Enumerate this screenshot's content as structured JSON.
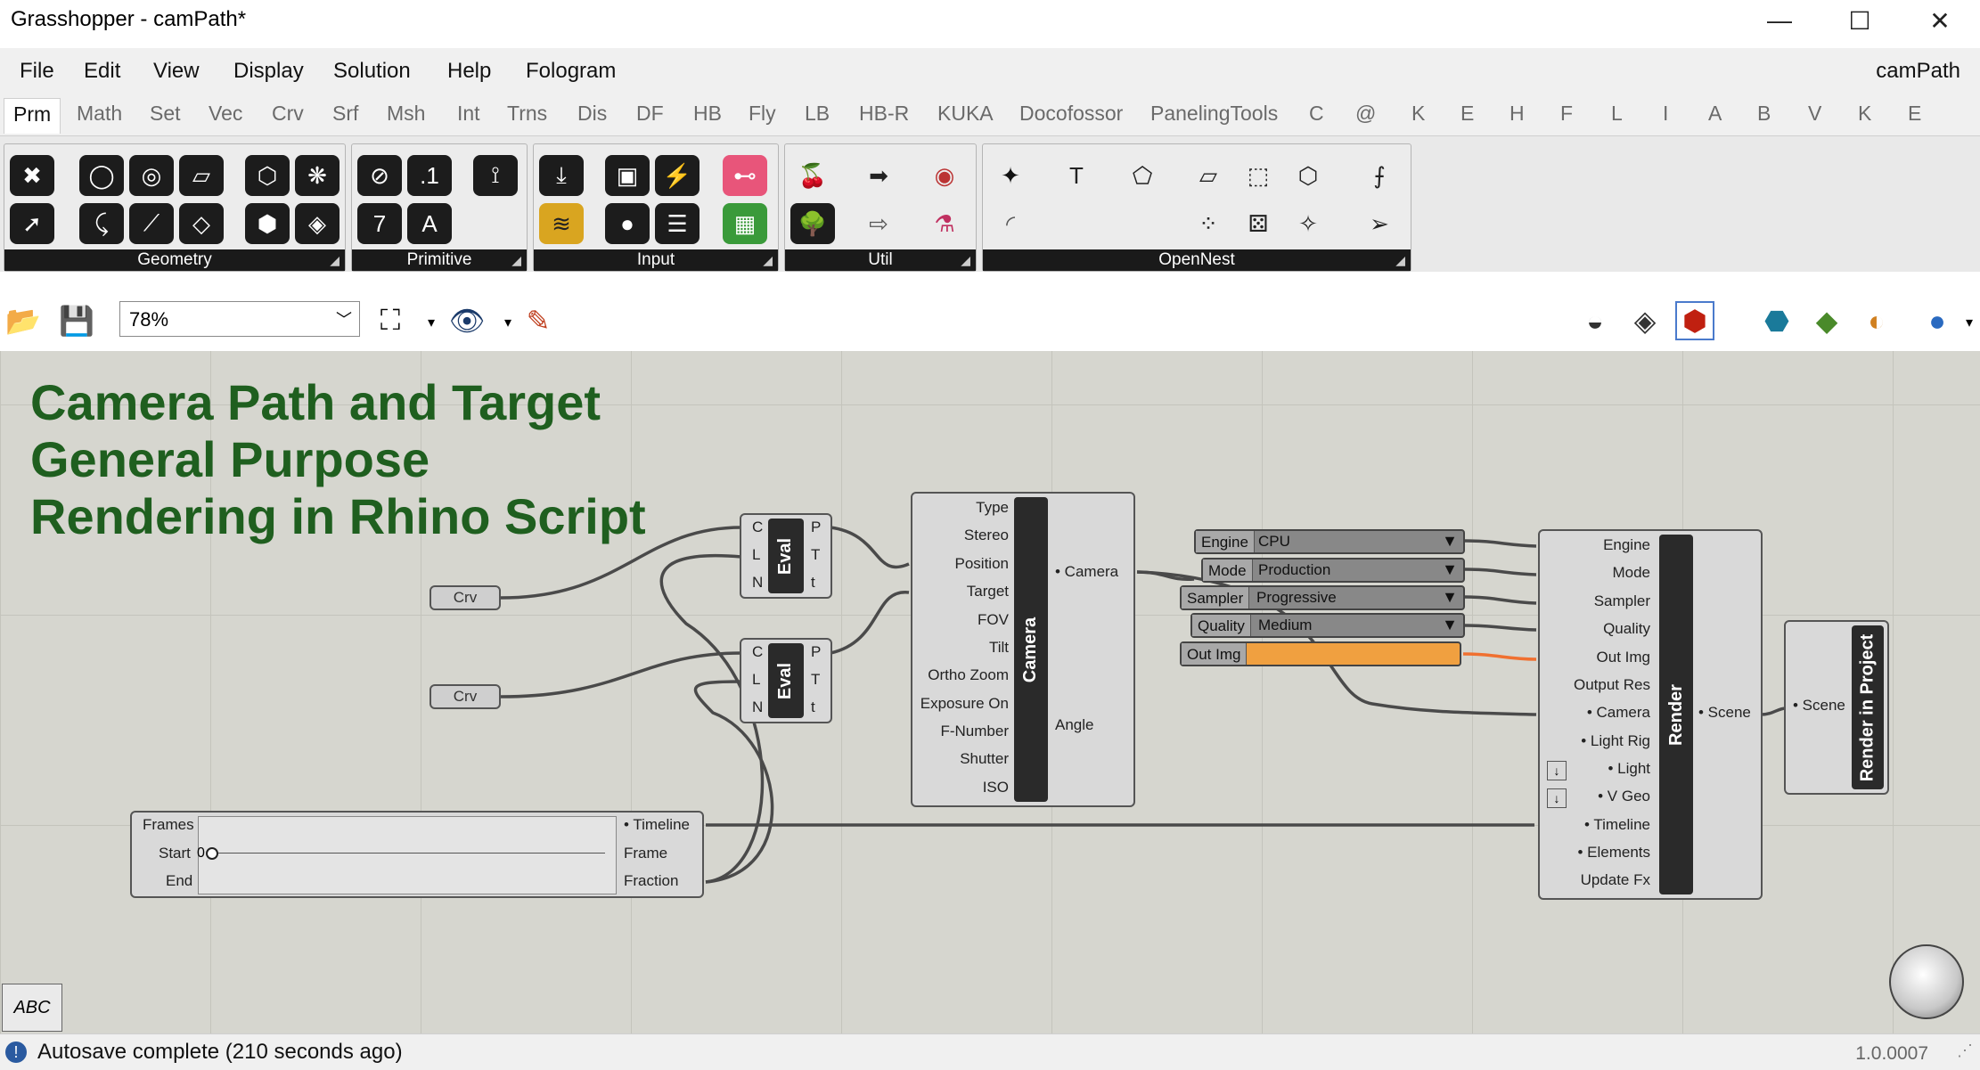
{
  "window": {
    "title": "Grasshopper - camPath*",
    "minimize": "—",
    "maximize": "☐",
    "close": "✕"
  },
  "menu": {
    "items": [
      "File",
      "Edit",
      "View",
      "Display",
      "Solution",
      "Help",
      "Fologram"
    ],
    "document_name": "camPath"
  },
  "tabs": [
    "Prm",
    "Math",
    "Set",
    "Vec",
    "Crv",
    "Srf",
    "Msh",
    "Int",
    "Trns",
    "Dis",
    "DF",
    "HB",
    "Fly",
    "LB",
    "HB-R",
    "KUKA",
    "Docofossor",
    "PanelingTools",
    "C",
    "@",
    "K",
    "E",
    "H",
    "F",
    "L",
    "I",
    "A",
    "B",
    "V",
    "K",
    "E"
  ],
  "active_tab": "Prm",
  "ribbon": {
    "panels": [
      "Geometry",
      "Primitive",
      "Input",
      "Util",
      "OpenNest"
    ]
  },
  "canvas_toolbar": {
    "zoom": "78%"
  },
  "note": {
    "line1": "Camera Path and Target",
    "line2": "General Purpose",
    "line3": "Rendering in Rhino Script"
  },
  "components": {
    "crv1": "Crv",
    "crv2": "Crv",
    "eval1": {
      "title": "Eval",
      "inputs": [
        "C",
        "L",
        "N"
      ],
      "outputs": [
        "P",
        "T",
        "t"
      ]
    },
    "eval2": {
      "title": "Eval",
      "inputs": [
        "C",
        "L",
        "N"
      ],
      "outputs": [
        "P",
        "T",
        "t"
      ]
    },
    "camera": {
      "title": "Camera",
      "inputs": [
        "Type",
        "Stereo",
        "Position",
        "Target",
        "FOV",
        "Tilt",
        "Ortho Zoom",
        "Exposure On",
        "F-Number",
        "Shutter",
        "ISO"
      ],
      "outputs": [
        "• Camera",
        "Angle"
      ]
    },
    "timeline": {
      "inputs": [
        "Frames",
        "Start",
        "End"
      ],
      "outputs": [
        "• Timeline",
        "Frame",
        "Fraction"
      ],
      "slider_value": "0"
    },
    "value_lists": [
      {
        "label": "Engine",
        "value": "CPU"
      },
      {
        "label": "Mode",
        "value": "Production"
      },
      {
        "label": "Sampler",
        "value": "Progressive"
      },
      {
        "label": "Quality",
        "value": "Medium"
      },
      {
        "label": "Out Img",
        "value": ""
      }
    ],
    "render": {
      "title": "Render",
      "inputs": [
        "Engine",
        "Mode",
        "Sampler",
        "Quality",
        "Out Img",
        "Output Res",
        "• Camera",
        "• Light Rig",
        "• Light",
        "• V Geo",
        "• Timeline",
        "• Elements",
        "Update Fx"
      ],
      "outputs": [
        "• Scene"
      ]
    },
    "render_in_project": {
      "title": "Render in Project",
      "inputs": [
        "• Scene"
      ]
    }
  },
  "status": {
    "text": "Autosave complete (210 seconds ago)",
    "version": "1.0.0007"
  },
  "colors": {
    "canvas": "#d6d6cf",
    "note_text": "#1f5f1f",
    "out_img_accent": "#f0a040",
    "component_strip": "#2a2a2a"
  }
}
